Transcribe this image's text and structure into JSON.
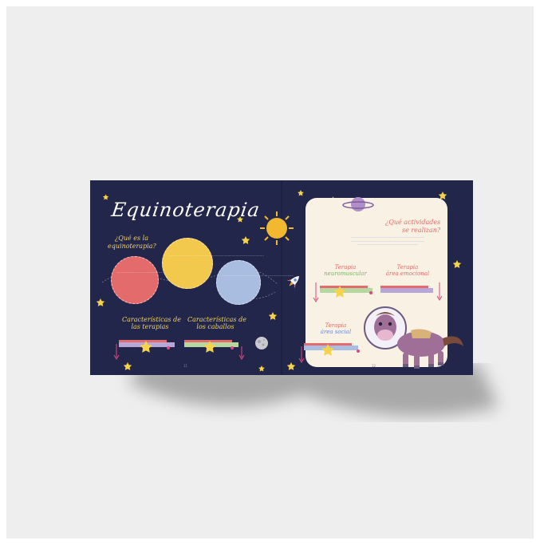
{
  "left_page": {
    "title": "Equinoterapia",
    "question_line1": "¿Qué es la",
    "question_line2": "equinoterapia?",
    "caption_1_line1": "Características de",
    "caption_1_line2": "las terapias",
    "caption_2_line1": "Características de",
    "caption_2_line2": "los caballos",
    "page_number": "11"
  },
  "right_page": {
    "title_line1": "¿Qué actividades",
    "title_line2": "se realizan?",
    "section_1_line1": "Terapia",
    "section_1_line2": "neuromuscular",
    "section_2_line1": "Terapia",
    "section_2_line2": "área emocional",
    "section_3_line1": "Terapia",
    "section_3_line2": "área social",
    "page_number": "12"
  },
  "colors": {
    "page_background": "#22264a",
    "card": "#f8f1e4",
    "circle_red": "#e36b6b",
    "circle_yellow": "#f2c94c",
    "circle_blue": "#a9bde0",
    "star": "#f6d34a",
    "arrow": "#e0487e"
  }
}
